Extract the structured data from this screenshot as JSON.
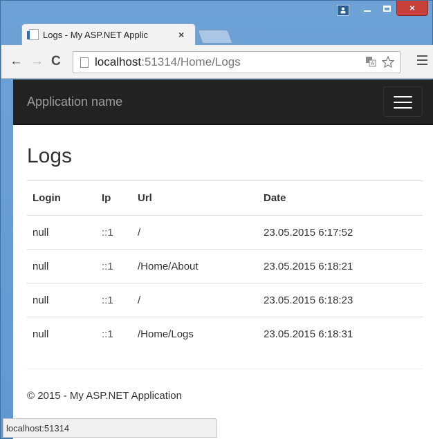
{
  "window": {
    "close_glyph": "×"
  },
  "tab": {
    "title": "Logs - My ASP.NET Applic",
    "close_glyph": "×"
  },
  "address": {
    "host": "localhost",
    "path": ":51314/Home/Logs"
  },
  "navbar": {
    "brand": "Application name"
  },
  "page": {
    "heading": "Logs"
  },
  "table": {
    "headers": [
      "Login",
      "Ip",
      "Url",
      "Date"
    ],
    "rows": [
      {
        "login": "null",
        "ip": "::1",
        "url": "/",
        "date": "23.05.2015 6:17:52"
      },
      {
        "login": "null",
        "ip": "::1",
        "url": "/Home/About",
        "date": "23.05.2015 6:18:21"
      },
      {
        "login": "null",
        "ip": "::1",
        "url": "/",
        "date": "23.05.2015 6:18:23"
      },
      {
        "login": "null",
        "ip": "::1",
        "url": "/Home/Logs",
        "date": "23.05.2015 6:18:31"
      }
    ]
  },
  "footer": {
    "text": "© 2015 - My ASP.NET Application"
  },
  "status": {
    "text": "localhost:51314"
  },
  "colors": {
    "navbar_bg": "#222222",
    "brand": "#9d9d9d",
    "close_btn": "#c7403a"
  },
  "icons": [
    "profile-icon",
    "minimize-icon",
    "maximize-icon",
    "close-icon",
    "back-icon",
    "forward-icon",
    "reload-icon",
    "page-icon",
    "translate-icon",
    "star-icon",
    "menu-icon",
    "hamburger-icon"
  ]
}
